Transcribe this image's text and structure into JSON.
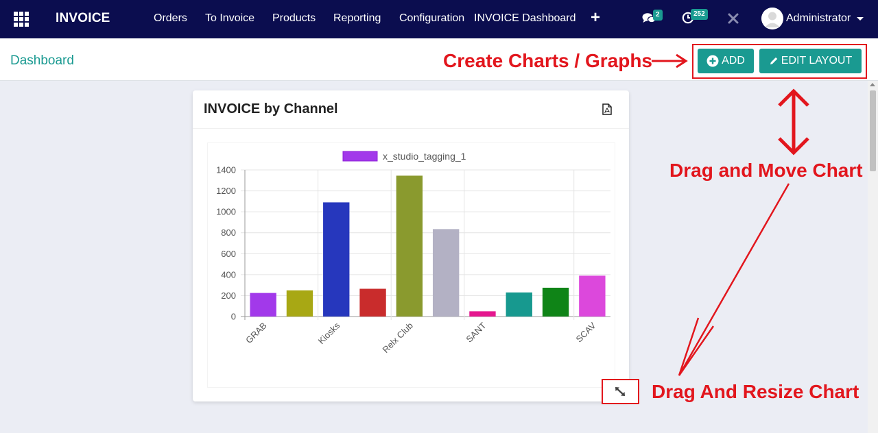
{
  "navbar": {
    "brand": "INVOICE",
    "menu": [
      "Orders",
      "To Invoice",
      "Products",
      "Reporting",
      "Configuration",
      "INVOICE Dashboard"
    ],
    "chat_count": "2",
    "activity_count": "252",
    "user_name": "Administrator"
  },
  "control": {
    "breadcrumb": "Dashboard",
    "add_label": "ADD",
    "edit_layout_label": "EDIT LAYOUT"
  },
  "annotations": {
    "create": "Create Charts / Graphs",
    "drag_move": "Drag and Move Chart",
    "drag_resize": "Drag And Resize Chart"
  },
  "card": {
    "title": "INVOICE by Channel"
  },
  "colors": {
    "navbar": "#0b0d4f",
    "accent": "#1a9a91",
    "annotation": "#e2161d"
  },
  "chart_data": {
    "type": "bar",
    "legend": "x_studio_tagging_1",
    "legend_color": "#a239ea",
    "categories": [
      "GRAB",
      "",
      "Kiosks",
      "",
      "Relx Club",
      "",
      "SANT",
      "",
      "",
      "SCAV"
    ],
    "values": [
      225,
      250,
      1090,
      265,
      1345,
      835,
      50,
      230,
      275,
      390
    ],
    "colors": [
      "#a239ea",
      "#a8a814",
      "#2637bd",
      "#c92c2c",
      "#8a9a2e",
      "#b3b1c4",
      "#e5178f",
      "#17998f",
      "#0f8417",
      "#dc48dc"
    ],
    "yticks": [
      0,
      200,
      400,
      600,
      800,
      1000,
      1200,
      1400
    ],
    "ylim": [
      0,
      1400
    ]
  }
}
